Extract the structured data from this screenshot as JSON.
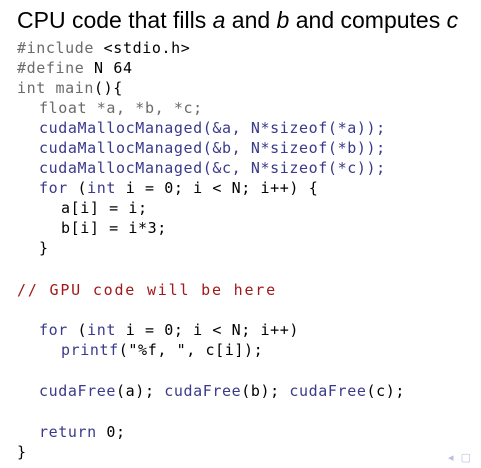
{
  "title": {
    "part1": "CPU code that fills ",
    "a": "a",
    "part2": " and ",
    "b": "b",
    "part3": " and computes ",
    "c": "c"
  },
  "code": {
    "l1_kw": "#include",
    "l1_rest": " <stdio.h>",
    "l2_kw": "#define",
    "l2_rest": " N 64",
    "l3_kw": "int main",
    "l3_rest": "(){",
    "l4_kw": "float",
    "l4_rest": " *a, *b, *c;",
    "l5_call": "cudaMallocManaged",
    "l5_rest": "(&a, N*sizeof(*a));",
    "l6_call": "cudaMallocManaged",
    "l6_rest": "(&b, N*sizeof(*b));",
    "l7_call": "cudaMallocManaged",
    "l7_rest": "(&c, N*sizeof(*c));",
    "l8_kw1": "for",
    "l8_mid": " (",
    "l8_kw2": "int",
    "l8_rest": " i = 0; i < N; i++) {",
    "l9": "a[i] = i;",
    "l10": "b[i] = i*3;",
    "l11": "}",
    "comment": "// GPU code will be here",
    "l13_kw1": "for",
    "l13_mid": " (",
    "l13_kw2": "int",
    "l13_rest": " i = 0; i < N; i++)",
    "l14_call": "printf",
    "l14_rest": "(\"%f, \", c[i]);",
    "l15_call1": "cudaFree",
    "l15_rest1": "(a); ",
    "l15_call2": "cudaFree",
    "l15_rest2": "(b); ",
    "l15_call3": "cudaFree",
    "l15_rest3": "(c);",
    "l16_kw": "return",
    "l16_rest": " 0;",
    "l17": "}"
  },
  "nav_icons": "◂ ▢"
}
